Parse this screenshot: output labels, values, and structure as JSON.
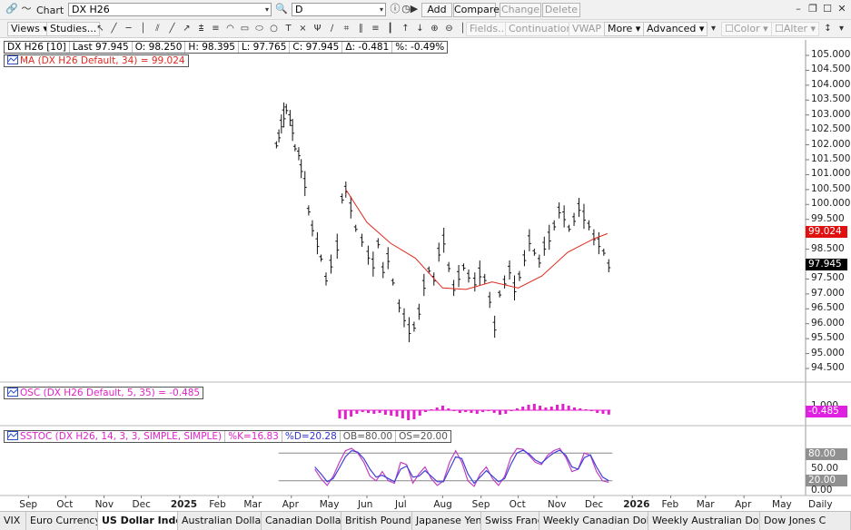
{
  "window": {
    "title": "Chart",
    "symbol_value": "DX H26",
    "period_value": "D",
    "buttons": {
      "add": "Add",
      "compare": "Compare",
      "change": "Change",
      "delete": "Delete"
    }
  },
  "toolbar": {
    "views": "Views",
    "studies": "Studies...",
    "fields": "Fields...",
    "continuation": "Continuation",
    "vwap": "VWAP",
    "more": "More",
    "advanced": "Advanced",
    "color": "Color",
    "alter": "Alter"
  },
  "quote": {
    "symbol": "DX H26 [10]",
    "last": "Last  97.945",
    "open": "O: 98.250",
    "high": "H: 98.395",
    "low": "L: 97.765",
    "close": "C: 97.945",
    "change": "Δ: -0.481",
    "pct": "%: -0.49%"
  },
  "ma_label": "MA (DX H26 Default, 34) = 99.024",
  "osc_label": "OSC (DX H26 Default, 5, 35) = -0.485",
  "sstoc": {
    "label": "SSTOC (DX H26, 14, 3, 3, SIMPLE, SIMPLE)",
    "k": "%K=16.83",
    "d": "%D=20.28",
    "ob": "OB=80.00",
    "os": "OS=20.00"
  },
  "price_axis": [
    "105.000",
    "104.500",
    "104.000",
    "103.500",
    "103.000",
    "102.500",
    "102.000",
    "101.500",
    "101.000",
    "100.500",
    "100.000",
    "99.500",
    "98.500",
    "97.500",
    "97.000",
    "96.500",
    "96.000",
    "95.500",
    "95.000",
    "94.500"
  ],
  "price_tags": {
    "ma": "99.024",
    "last": "97.945",
    "osc": "-0.485",
    "ob": "80.00",
    "os": "20.00"
  },
  "osc_axis": [
    "1.000"
  ],
  "sstoc_axis": [
    "50.00",
    "0.00"
  ],
  "x_axis": [
    "Sep",
    "Oct",
    "Nov",
    "Dec",
    "2025",
    "Feb",
    "Mar",
    "Apr",
    "May",
    "Jun",
    "Jul",
    "Aug",
    "Sep",
    "Oct",
    "Nov",
    "Dec",
    "2026",
    "Feb",
    "Mar",
    "Apr",
    "May"
  ],
  "interval_label": "Daily",
  "tabs": [
    "VIX",
    "Euro Currency",
    "US Dollar Index",
    "Australian Dollar",
    "Canadian Dollar",
    "British Pound",
    "Japanese Yen",
    "Swiss Franc",
    "Weekly Canadian Dollar",
    "Weekly Australian Dollar",
    "Dow Jones C"
  ],
  "active_tab": "US Dollar Index",
  "colors": {
    "ma": "#e0281e",
    "osc": "#e020c8",
    "k_line": "#c040c0",
    "d_line": "#4040d8",
    "price_tag": "#e01010",
    "last_tag": "#000000",
    "osc_tag": "#e020e0",
    "band_tag": "#909090"
  },
  "chart_data": [
    {
      "type": "bar",
      "title": "",
      "series": [
        {
          "name": "DX H26",
          "kind": "ohlc"
        },
        {
          "name": "MA (DX H26 Default, 34)",
          "last": 99.024
        }
      ],
      "last": 97.945,
      "ylim": [
        94.3,
        105.3
      ],
      "date_range": [
        "2024-09",
        "2026-05"
      ],
      "points": [
        [
          "2025-03-20",
          102.0
        ],
        [
          "2025-03-22",
          102.3
        ],
        [
          "2025-03-24",
          102.7
        ],
        [
          "2025-03-26",
          103.0
        ],
        [
          "2025-03-28",
          103.2
        ],
        [
          "2025-03-31",
          102.9
        ],
        [
          "2025-04-02",
          102.5
        ],
        [
          "2025-04-04",
          101.9
        ],
        [
          "2025-04-07",
          101.7
        ],
        [
          "2025-04-09",
          101.2
        ],
        [
          "2025-04-12",
          100.7
        ],
        [
          "2025-04-15",
          99.8
        ],
        [
          "2025-04-18",
          99.2
        ],
        [
          "2025-04-22",
          98.7
        ],
        [
          "2025-04-25",
          98.2
        ],
        [
          "2025-04-29",
          97.5
        ],
        [
          "2025-05-03",
          98.0
        ],
        [
          "2025-05-08",
          98.6
        ],
        [
          "2025-05-12",
          100.2
        ],
        [
          "2025-05-15",
          100.5
        ],
        [
          "2025-05-19",
          99.9
        ],
        [
          "2025-05-23",
          99.2
        ],
        [
          "2025-05-28",
          98.8
        ],
        [
          "2025-06-02",
          98.3
        ],
        [
          "2025-06-06",
          98.0
        ],
        [
          "2025-06-10",
          98.7
        ],
        [
          "2025-06-14",
          97.8
        ],
        [
          "2025-06-18",
          98.2
        ],
        [
          "2025-06-22",
          97.4
        ],
        [
          "2025-06-27",
          96.6
        ],
        [
          "2025-07-01",
          96.2
        ],
        [
          "2025-07-05",
          95.8
        ],
        [
          "2025-07-09",
          95.9
        ],
        [
          "2025-07-13",
          96.4
        ],
        [
          "2025-07-17",
          97.3
        ],
        [
          "2025-07-21",
          97.8
        ],
        [
          "2025-07-25",
          97.5
        ],
        [
          "2025-07-29",
          98.4
        ],
        [
          "2025-08-02",
          98.8
        ],
        [
          "2025-08-06",
          97.9
        ],
        [
          "2025-08-10",
          97.2
        ],
        [
          "2025-08-14",
          97.6
        ],
        [
          "2025-08-18",
          97.9
        ],
        [
          "2025-08-22",
          97.6
        ],
        [
          "2025-08-27",
          97.4
        ],
        [
          "2025-08-31",
          97.7
        ],
        [
          "2025-09-04",
          97.5
        ],
        [
          "2025-09-08",
          96.8
        ],
        [
          "2025-09-12",
          95.9
        ],
        [
          "2025-09-16",
          97.0
        ],
        [
          "2025-09-20",
          97.4
        ],
        [
          "2025-09-24",
          97.8
        ],
        [
          "2025-09-28",
          97.2
        ],
        [
          "2025-10-02",
          97.6
        ],
        [
          "2025-10-06",
          98.2
        ],
        [
          "2025-10-10",
          98.8
        ],
        [
          "2025-10-14",
          98.4
        ],
        [
          "2025-10-18",
          98.1
        ],
        [
          "2025-10-22",
          98.6
        ],
        [
          "2025-10-26",
          98.9
        ],
        [
          "2025-10-30",
          99.3
        ],
        [
          "2025-11-03",
          99.8
        ],
        [
          "2025-11-07",
          99.6
        ],
        [
          "2025-11-11",
          99.2
        ],
        [
          "2025-11-15",
          99.5
        ],
        [
          "2025-11-19",
          99.9
        ],
        [
          "2025-11-23",
          99.6
        ],
        [
          "2025-11-27",
          99.3
        ],
        [
          "2025-12-01",
          98.9
        ],
        [
          "2025-12-05",
          98.7
        ],
        [
          "2025-12-09",
          98.4
        ],
        [
          "2025-12-13",
          97.945
        ]
      ],
      "ma_points": [
        [
          "2025-05-15",
          100.5
        ],
        [
          "2025-06-01",
          99.4
        ],
        [
          "2025-06-20",
          98.7
        ],
        [
          "2025-07-10",
          98.2
        ],
        [
          "2025-08-01",
          97.2
        ],
        [
          "2025-08-20",
          97.15
        ],
        [
          "2025-09-10",
          97.4
        ],
        [
          "2025-10-01",
          97.2
        ],
        [
          "2025-10-20",
          97.6
        ],
        [
          "2025-11-10",
          98.4
        ],
        [
          "2025-12-01",
          98.85
        ],
        [
          "2025-12-12",
          99.024
        ]
      ]
    },
    {
      "type": "bar",
      "title": "",
      "series": [
        {
          "name": "OSC (DX H26 Default, 5, 35)",
          "last": -0.485
        }
      ],
      "ylim": [
        -1.5,
        1.5
      ],
      "date_range": [
        "2025-05-10",
        "2025-12-13"
      ],
      "values": [
        -0.9,
        -1.0,
        -0.7,
        -0.4,
        -0.2,
        -0.3,
        -0.4,
        -0.3,
        -0.5,
        -0.6,
        -0.7,
        -0.9,
        -1.1,
        -1.0,
        -0.6,
        -0.2,
        0.1,
        0.3,
        0.5,
        0.2,
        -0.1,
        -0.3,
        -0.2,
        -0.3,
        -0.4,
        -0.2,
        -0.1,
        -0.3,
        -0.5,
        -0.4,
        -0.1,
        0.2,
        0.4,
        0.6,
        0.7,
        0.5,
        0.3,
        0.4,
        0.6,
        0.7,
        0.5,
        0.3,
        0.2,
        0.1,
        -0.1,
        -0.3,
        -0.4,
        -0.485
      ]
    },
    {
      "type": "line",
      "title": "",
      "series": [
        {
          "name": "%K",
          "last": 16.83
        },
        {
          "name": "%D",
          "last": 20.28
        }
      ],
      "ylim": [
        0,
        100
      ],
      "overbought": 80,
      "oversold": 20,
      "date_range": [
        "2025-04-20",
        "2025-12-13"
      ],
      "k": [
        45,
        25,
        10,
        30,
        60,
        85,
        90,
        80,
        60,
        30,
        20,
        40,
        20,
        15,
        60,
        55,
        15,
        35,
        50,
        25,
        10,
        20,
        60,
        85,
        60,
        20,
        8,
        35,
        50,
        25,
        10,
        30,
        70,
        90,
        88,
        75,
        60,
        55,
        75,
        85,
        90,
        70,
        40,
        45,
        80,
        75,
        40,
        20,
        16.83
      ],
      "d": [
        50,
        35,
        18,
        25,
        48,
        72,
        85,
        82,
        68,
        45,
        28,
        32,
        25,
        18,
        45,
        52,
        28,
        30,
        42,
        30,
        18,
        18,
        45,
        72,
        68,
        35,
        15,
        28,
        42,
        30,
        18,
        25,
        55,
        80,
        86,
        78,
        65,
        58,
        70,
        80,
        86,
        75,
        50,
        45,
        70,
        76,
        50,
        28,
        20.28
      ]
    }
  ]
}
